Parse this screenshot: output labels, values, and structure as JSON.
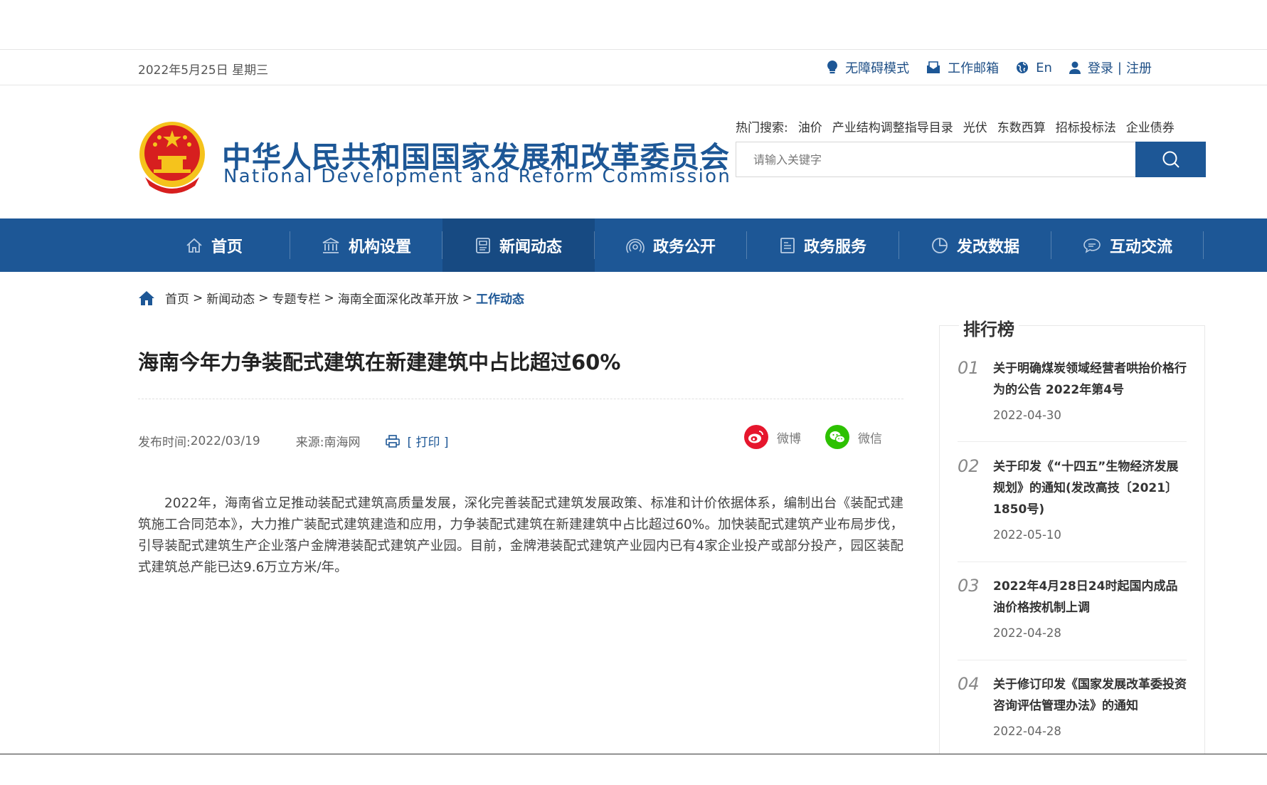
{
  "topbar": {
    "date": "2022年5月25日 星期三",
    "links": {
      "accessibility": "无障碍模式",
      "mailbox": "工作邮箱",
      "english": "En",
      "login": "登录",
      "divider": "|",
      "register": "注册"
    }
  },
  "header": {
    "org_cn": "中华人民共和国国家发展和改革委员会",
    "org_en": "National Development and Reform Commission",
    "hot_label": "热门搜索:",
    "hot_keywords": [
      "油价",
      "产业结构调整指导目录",
      "光伏",
      "东数西算",
      "招标投标法",
      "企业债券"
    ],
    "search_placeholder": "请输入关键字"
  },
  "nav": {
    "items": [
      "首页",
      "机构设置",
      "新闻动态",
      "政务公开",
      "政务服务",
      "发改数据",
      "互动交流"
    ],
    "active_index": 2
  },
  "breadcrumb": {
    "items": [
      "首页",
      "新闻动态",
      "专题专栏",
      "海南全面深化改革开放"
    ],
    "current": "工作动态",
    "separator": ">"
  },
  "article": {
    "title": "海南今年力争装配式建筑在新建建筑中占比超过60%",
    "publish_label": "发布时间:",
    "publish_date": "2022/03/19",
    "source_label": "来源:",
    "source": "南海网",
    "print_label": "[ 打印 ]",
    "share_weibo": "微博",
    "share_wechat": "微信",
    "body": "2022年，海南省立足推动装配式建筑高质量发展，深化完善装配式建筑发展政策、标准和计价依据体系，编制出台《装配式建筑施工合同范本》，大力推广装配式建筑建造和应用，力争装配式建筑在新建建筑中占比超过60%。加快装配式建筑产业布局步伐，引导装配式建筑生产企业落户金牌港装配式建筑产业园。目前，金牌港装配式建筑产业园内已有4家企业投产或部分投产，园区装配式建筑总产能已达9.6万立方米/年。"
  },
  "ranking": {
    "title": "排行榜",
    "items": [
      {
        "num": "01",
        "title": "关于明确煤炭领域经营者哄抬价格行为的公告 2022年第4号",
        "date": "2022-04-30"
      },
      {
        "num": "02",
        "title": "关于印发《“十四五”生物经济发展规划》的通知(发改高技〔2021〕1850号)",
        "date": "2022-05-10"
      },
      {
        "num": "03",
        "title": "2022年4月28日24时起国内成品油价格按机制上调",
        "date": "2022-04-28"
      },
      {
        "num": "04",
        "title": "关于修订印发《国家发展改革委投资咨询评估管理办法》的通知",
        "date": "2022-04-28"
      }
    ]
  },
  "colors": {
    "brand_blue": "#1d5796",
    "nav_active": "#174a82",
    "weibo_red": "#e6162d",
    "wechat_green": "#2dc100",
    "emblem_red": "#d71f1f",
    "emblem_gold": "#f5c31c"
  },
  "icons": {
    "accessibility": "lightbulb-icon",
    "mailbox": "mail-icon",
    "english": "globe-icon",
    "login": "user-icon",
    "search": "search-icon",
    "breadcrumb": "home-icon",
    "print": "printer-icon",
    "weibo": "weibo-icon",
    "wechat": "wechat-icon"
  }
}
